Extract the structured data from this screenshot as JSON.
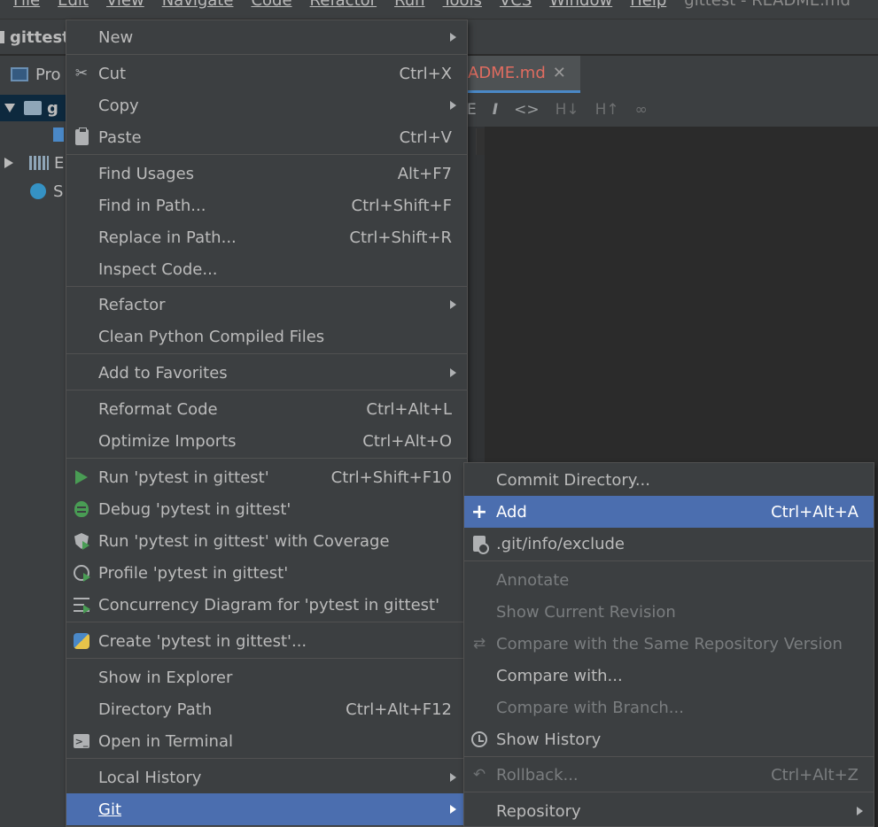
{
  "ide": {
    "menubar": [
      "File",
      "Edit",
      "View",
      "Navigate",
      "Code",
      "Refactor",
      "Run",
      "Tools",
      "VCS",
      "Window",
      "Help",
      "gittest - README.md"
    ],
    "nav_root": "gittest",
    "project_tab": "Pro",
    "tree": [
      {
        "label": "g"
      },
      {
        "label": "E"
      },
      {
        "label": "S"
      }
    ],
    "editor_tab": "ADME.md",
    "editor_tab_close": "✕",
    "md_toolbar": [
      "E",
      "I",
      "<>",
      "H↓",
      "H↑",
      "∞"
    ]
  },
  "main_menu": {
    "items": [
      {
        "label": "New",
        "shortcut": "",
        "submenu": true,
        "icon": ""
      },
      {
        "label": "Cut",
        "shortcut": "Ctrl+X",
        "submenu": false,
        "icon": "scissors-icon"
      },
      {
        "label": "Copy",
        "shortcut": "",
        "submenu": true,
        "icon": ""
      },
      {
        "label": "Paste",
        "shortcut": "Ctrl+V",
        "submenu": false,
        "icon": "clipboard-icon"
      },
      {
        "label": "Find Usages",
        "shortcut": "Alt+F7",
        "submenu": false,
        "icon": ""
      },
      {
        "label": "Find in Path...",
        "shortcut": "Ctrl+Shift+F",
        "submenu": false,
        "icon": ""
      },
      {
        "label": "Replace in Path...",
        "shortcut": "Ctrl+Shift+R",
        "submenu": false,
        "icon": ""
      },
      {
        "label": "Inspect Code...",
        "shortcut": "",
        "submenu": false,
        "icon": ""
      },
      {
        "label": "Refactor",
        "shortcut": "",
        "submenu": true,
        "icon": ""
      },
      {
        "label": "Clean Python Compiled Files",
        "shortcut": "",
        "submenu": false,
        "icon": ""
      },
      {
        "label": "Add to Favorites",
        "shortcut": "",
        "submenu": true,
        "icon": ""
      },
      {
        "label": "Reformat Code",
        "shortcut": "Ctrl+Alt+L",
        "submenu": false,
        "icon": ""
      },
      {
        "label": "Optimize Imports",
        "shortcut": "Ctrl+Alt+O",
        "submenu": false,
        "icon": ""
      },
      {
        "label": "Run 'pytest in gittest'",
        "shortcut": "Ctrl+Shift+F10",
        "submenu": false,
        "icon": "play-icon"
      },
      {
        "label": "Debug 'pytest in gittest'",
        "shortcut": "",
        "submenu": false,
        "icon": "bug-icon"
      },
      {
        "label": "Run 'pytest in gittest' with Coverage",
        "shortcut": "",
        "submenu": false,
        "icon": "coverage-shield-icon"
      },
      {
        "label": "Profile 'pytest in gittest'",
        "shortcut": "",
        "submenu": false,
        "icon": "profile-clock-icon"
      },
      {
        "label": "Concurrency Diagram for 'pytest in gittest'",
        "shortcut": "",
        "submenu": false,
        "icon": "concurrency-icon"
      },
      {
        "label": "Create 'pytest in gittest'...",
        "shortcut": "",
        "submenu": false,
        "icon": "python-icon"
      },
      {
        "label": "Show in Explorer",
        "shortcut": "",
        "submenu": false,
        "icon": ""
      },
      {
        "label": "Directory Path",
        "shortcut": "Ctrl+Alt+F12",
        "submenu": false,
        "icon": ""
      },
      {
        "label": "Open in Terminal",
        "shortcut": "",
        "submenu": false,
        "icon": "terminal-icon"
      },
      {
        "label": "Local History",
        "shortcut": "",
        "submenu": true,
        "icon": ""
      },
      {
        "label": "Git",
        "shortcut": "",
        "submenu": true,
        "icon": ""
      }
    ]
  },
  "git_submenu": {
    "items": [
      {
        "label": "Commit Directory...",
        "shortcut": "",
        "disabled": false
      },
      {
        "label": "Add",
        "shortcut": "Ctrl+Alt+A",
        "disabled": false
      },
      {
        "label": ".git/info/exclude",
        "shortcut": "",
        "disabled": false
      },
      {
        "label": "Annotate",
        "shortcut": "",
        "disabled": true
      },
      {
        "label": "Show Current Revision",
        "shortcut": "",
        "disabled": true
      },
      {
        "label": "Compare with the Same Repository Version",
        "shortcut": "",
        "disabled": true
      },
      {
        "label": "Compare with...",
        "shortcut": "",
        "disabled": false
      },
      {
        "label": "Compare with Branch...",
        "shortcut": "",
        "disabled": true
      },
      {
        "label": "Show History",
        "shortcut": "",
        "disabled": false
      },
      {
        "label": "Rollback...",
        "shortcut": "Ctrl+Alt+Z",
        "disabled": true
      },
      {
        "label": "Repository",
        "shortcut": "",
        "disabled": false,
        "submenu": true
      }
    ]
  },
  "colors": {
    "menu_bg": "#3c3f41",
    "selection": "#4b6eaf",
    "text": "#bbbbbb",
    "disabled_text": "#7a7d7f",
    "run_green": "#499c54",
    "tab_title_red": "#e06c60"
  }
}
